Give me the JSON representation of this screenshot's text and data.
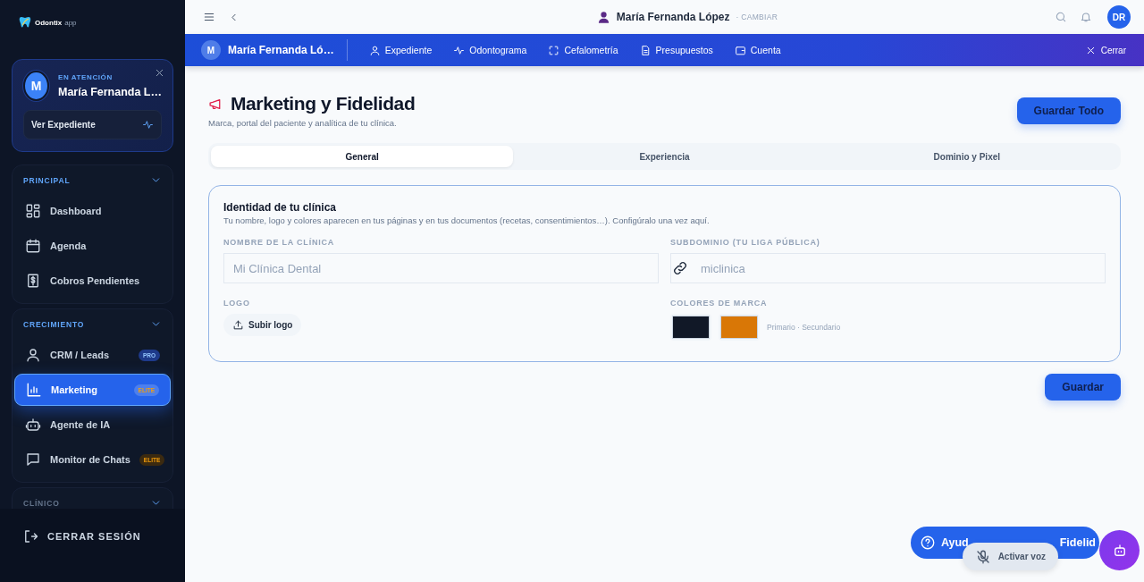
{
  "sidebar": {
    "logo": {
      "name": "Odontix",
      "suffix": "app"
    },
    "patient_card": {
      "label": "EN ATENCIÓN",
      "avatar": "M",
      "name": "María Fernanda L…",
      "button": "Ver Expediente"
    },
    "sections": [
      {
        "title": "PRINCIPAL",
        "items": [
          {
            "label": "Dashboard",
            "selected": false
          },
          {
            "label": "Agenda",
            "selected": false
          },
          {
            "label": "Cobros Pendientes",
            "selected": false
          }
        ]
      },
      {
        "title": "CRECIMIENTO",
        "items": [
          {
            "label": "CRM / Leads",
            "selected": false,
            "badge": {
              "text": "PRO",
              "kind": "pro"
            }
          },
          {
            "label": "Marketing",
            "selected": true,
            "badge": {
              "text": "ELITE",
              "kind": "elite"
            }
          },
          {
            "label": "Agente de IA",
            "selected": false
          },
          {
            "label": "Monitor de Chats",
            "selected": false,
            "badge": {
              "text": "ELITE",
              "kind": "elite"
            }
          }
        ]
      },
      {
        "title": "CLÍNICO"
      }
    ],
    "logout": "CERRAR SESIÓN"
  },
  "topbar": {
    "patient_name": "María Fernanda López",
    "change": "· CAMBIAR",
    "avatar": "DR"
  },
  "patient_bar": {
    "avatar": "M",
    "name": "María Fernanda Ló…",
    "links": [
      {
        "label": "Expediente"
      },
      {
        "label": "Odontograma"
      },
      {
        "label": "Cefalometría"
      },
      {
        "label": "Presupuestos"
      },
      {
        "label": "Cuenta"
      }
    ],
    "close": "Cerrar"
  },
  "page": {
    "title": "Marketing y Fidelidad",
    "subtitle": "Marca, portal del paciente y analítica de tu clínica.",
    "save_all": "Guardar Todo",
    "tabs": [
      {
        "label": "General",
        "selected": true
      },
      {
        "label": "Experiencia",
        "selected": false
      },
      {
        "label": "Dominio y Pixel",
        "selected": false
      }
    ],
    "card": {
      "title": "Identidad de tu clínica",
      "description": "Tu nombre, logo y colores aparecen en tus páginas y en tus documentos (recetas, consentimientos…). Configúralo una vez aquí.",
      "clinic_name": {
        "label": "NOMBRE DE LA CLÍNICA",
        "placeholder": "Mi Clínica Dental"
      },
      "subdomain": {
        "label": "SUBDOMINIO (TU LIGA PÚBLICA)",
        "placeholder": "miclinica"
      },
      "logo": {
        "label": "LOGO",
        "button": "Subir logo"
      },
      "brand_colors": {
        "label": "COLORES DE MARCA",
        "swatches": [
          {
            "color": "#111827"
          },
          {
            "color": "#d97706"
          }
        ],
        "caption": "Primario · Secundario"
      }
    },
    "save": "Guardar"
  },
  "help": {
    "label_start": "Ayud",
    "label_end": "Fidelid",
    "voice": "Activar voz"
  }
}
